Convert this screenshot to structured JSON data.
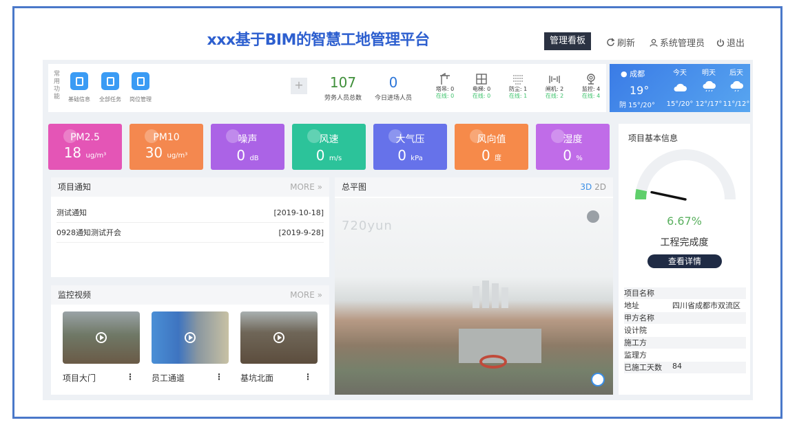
{
  "header": {
    "title": "xxx基于BIM的智慧工地管理平台",
    "board_button": "管理看板",
    "refresh": "刷新",
    "user": "系统管理员",
    "logout": "退出"
  },
  "quick": {
    "section_label": "常用功能",
    "items": [
      {
        "label": "基础信息",
        "icon": "document-icon"
      },
      {
        "label": "全部任务",
        "icon": "document-icon"
      },
      {
        "label": "岗位管理",
        "icon": "document-icon"
      }
    ],
    "add": "+"
  },
  "stats": [
    {
      "value": "107",
      "label": "劳务人员总数",
      "color": "#3f8f3a"
    },
    {
      "value": "0",
      "label": "今日进场人员",
      "color": "#2d76d8"
    }
  ],
  "devices": [
    {
      "name": "塔吊: 0",
      "online": "在线: 0",
      "icon": "tower-crane-icon"
    },
    {
      "name": "电梯: 0",
      "online": "在线: 0",
      "icon": "elevator-icon"
    },
    {
      "name": "防尘: 1",
      "online": "在线: 1",
      "icon": "dust-icon"
    },
    {
      "name": "闸机: 2",
      "online": "在线: 2",
      "icon": "gate-icon"
    },
    {
      "name": "监控: 4",
      "online": "在线: 4",
      "icon": "monitor-icon"
    }
  ],
  "weather": {
    "city": "成都",
    "temp": "19°",
    "desc": "阴 15°/20°",
    "days": [
      {
        "name": "今天",
        "range": "15°/20°"
      },
      {
        "name": "明天",
        "range": "12°/17°"
      },
      {
        "name": "后天",
        "range": "11°/12°"
      }
    ]
  },
  "env": [
    {
      "title": "PM2.5",
      "value": "18",
      "unit": "ug/m³",
      "color": "#e455b6"
    },
    {
      "title": "PM10",
      "value": "30",
      "unit": "ug/m³",
      "color": "#f4884f"
    },
    {
      "title": "噪声",
      "value": "0",
      "unit": "dB",
      "color": "#ab63e6"
    },
    {
      "title": "风速",
      "value": "0",
      "unit": "m/s",
      "color": "#2cc39a"
    },
    {
      "title": "大气压",
      "value": "0",
      "unit": "kPa",
      "color": "#6672ea"
    },
    {
      "title": "风向值",
      "value": "0",
      "unit": "度",
      "color": "#f68a4a"
    },
    {
      "title": "湿度",
      "value": "0",
      "unit": "%",
      "color": "#c06ce8"
    }
  ],
  "notice": {
    "title": "项目通知",
    "more": "MORE",
    "items": [
      {
        "text": "测试通知",
        "date": "[2019-10-18]"
      },
      {
        "text": "0928通知测试开会",
        "date": "[2019-9-28]"
      }
    ]
  },
  "monitor": {
    "title": "监控视频",
    "more": "MORE",
    "cams": [
      {
        "name": "项目大门"
      },
      {
        "name": "员工通道"
      },
      {
        "name": "基坑北面"
      }
    ]
  },
  "plan": {
    "title": "总平图",
    "mode_3d": "3D",
    "mode_2d": "2D",
    "watermark": "720yun"
  },
  "project": {
    "title": "项目基本信息",
    "progress_value": 6.67,
    "progress_text": "6.67%",
    "progress_label": "工程完成度",
    "detail_button": "查看详情",
    "rows": [
      {
        "k": "项目名称",
        "v": ""
      },
      {
        "k": "地址",
        "v": "四川省成都市双流区"
      },
      {
        "k": "甲方名称",
        "v": ""
      },
      {
        "k": "设计院",
        "v": ""
      },
      {
        "k": "施工方",
        "v": ""
      },
      {
        "k": "监理方",
        "v": ""
      },
      {
        "k": "已施工天数",
        "v": "84"
      }
    ]
  }
}
